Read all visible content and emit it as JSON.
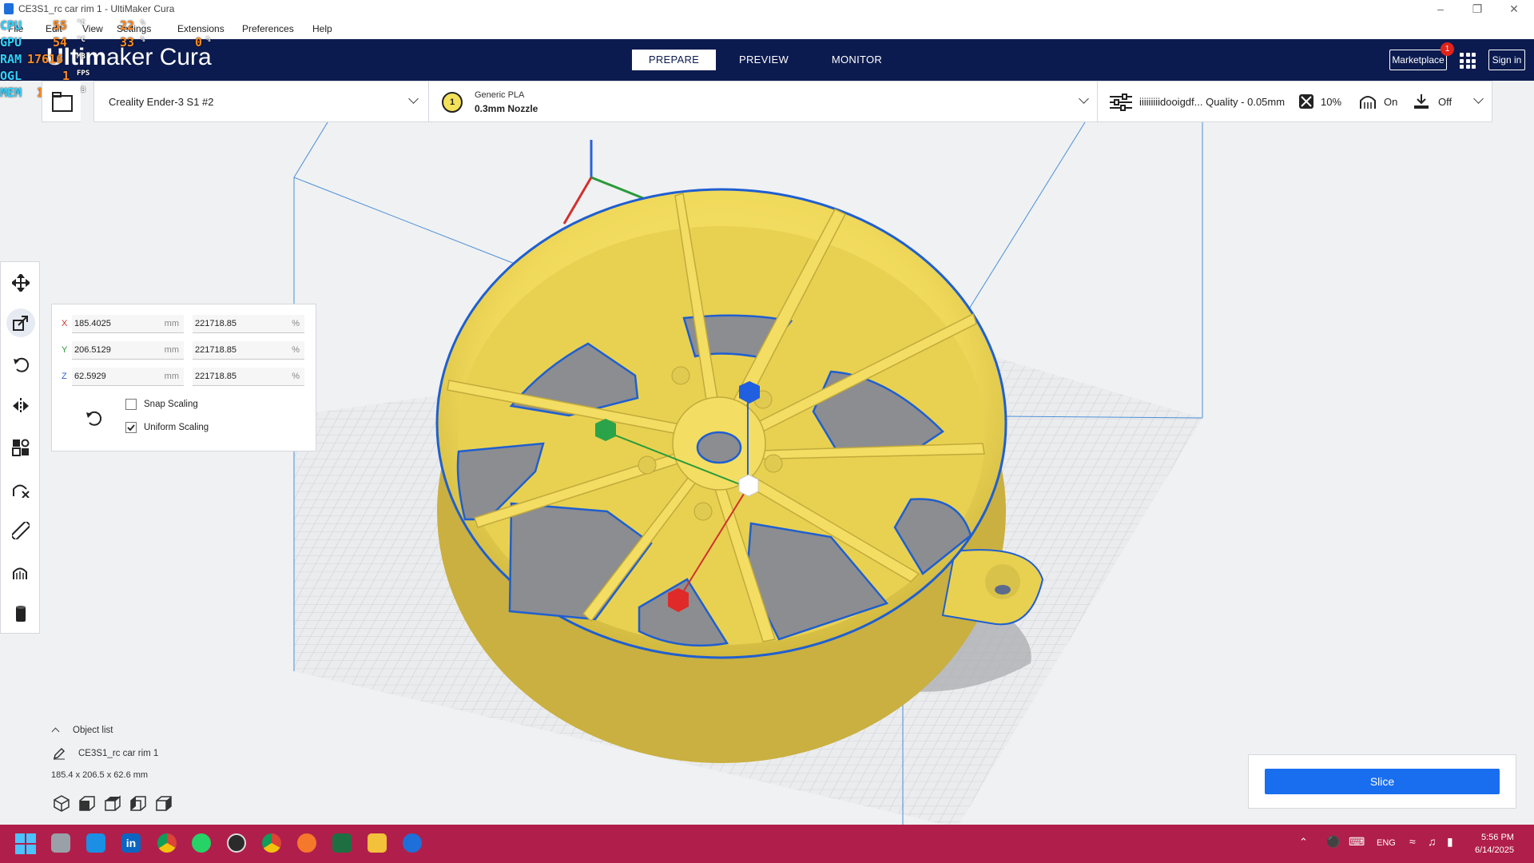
{
  "window": {
    "title": "CE3S1_rc car rim 1 - UltiMaker Cura"
  },
  "menu": [
    "File",
    "Edit",
    "View",
    "Settings",
    "Extensions",
    "Preferences",
    "Help"
  ],
  "perf_overlay": {
    "rows": [
      {
        "label": "CPU",
        "v1": "55",
        "u1": "°C",
        "v2": "22",
        "u2": "%"
      },
      {
        "label": "GPU",
        "v1": "54",
        "u1": "°C",
        "v2": "33",
        "u2": "%",
        "v3": "0",
        "u3": "%"
      },
      {
        "label": "RAM",
        "v1": "17616",
        "u1": "MB"
      },
      {
        "label": "OGL",
        "v1": "1",
        "u1": "FPS"
      },
      {
        "label": "MEM",
        "v1": "1546",
        "u1": "MB"
      }
    ]
  },
  "header": {
    "logo_a": "Ultim",
    "logo_b": "aker Cura",
    "tabs": [
      "PREPARE",
      "PREVIEW",
      "MONITOR"
    ],
    "active_tab": "PREPARE",
    "marketplace": "Marketplace",
    "marketplace_badge": "1",
    "sign_in": "Sign in"
  },
  "printer": {
    "name": "Creality Ender-3 S1 #2"
  },
  "material": {
    "extruder": "1",
    "name": "Generic PLA",
    "nozzle": "0.3mm Nozzle"
  },
  "print_settings": {
    "profile": "iiiiiiiiidooigdf... Quality - 0.05mm",
    "infill": "10%",
    "support": "On",
    "adhesion": "Off"
  },
  "tools": [
    "move-tool",
    "scale-tool",
    "rotate-tool",
    "mirror-tool",
    "per-model-settings-tool",
    "support-blocker-tool",
    "measure-tool",
    "paint-tool",
    "cylinder-tool"
  ],
  "scale_panel": {
    "x": {
      "label": "X",
      "mm": "185.4025",
      "pct": "221718.85"
    },
    "y": {
      "label": "Y",
      "mm": "206.5129",
      "pct": "221718.85"
    },
    "z": {
      "label": "Z",
      "mm": "62.5929",
      "pct": "221718.85"
    },
    "unit_mm": "mm",
    "unit_pct": "%",
    "snap_scaling": {
      "label": "Snap Scaling",
      "checked": false
    },
    "uniform_scaling": {
      "label": "Uniform Scaling",
      "checked": true
    }
  },
  "object_list": {
    "title": "Object list",
    "object_name": "CE3S1_rc car rim 1",
    "dimensions": "185.4 x 206.5 x 62.6 mm",
    "view_buttons": [
      "3d-view",
      "front-view",
      "top-view",
      "left-view",
      "right-view"
    ]
  },
  "slice": {
    "label": "Slice"
  },
  "taskbar": {
    "apps": [
      "windows-start",
      "file-manager",
      "outlook",
      "linkedin",
      "chrome-1",
      "whatsapp",
      "obs",
      "chrome-2",
      "blender",
      "excel",
      "explorer",
      "cura"
    ],
    "lang": "ENG",
    "time": "5:56 PM",
    "date": "6/14/2025"
  },
  "colors": {
    "header": "#0c1b4f",
    "accent": "#196ef0",
    "model": "#f2e060",
    "outline": "#1f5fd0",
    "taskbar": "#b01f4b"
  }
}
